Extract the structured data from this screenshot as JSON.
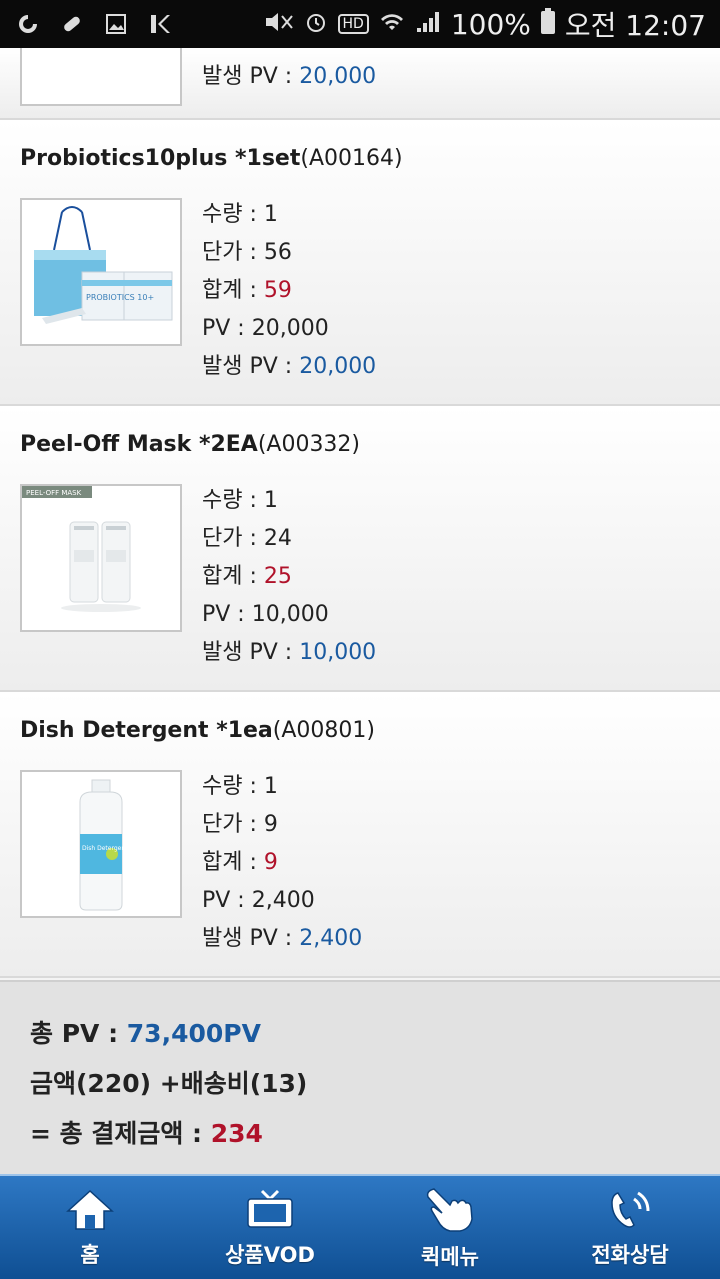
{
  "statusbar": {
    "left_icons": [
      "sync-icon",
      "pill-icon",
      "image-icon",
      "k-icon"
    ],
    "right_icons": [
      "mute-icon",
      "alarm-icon",
      "hd-icon",
      "wifi-icon",
      "signal-icon"
    ],
    "battery_text": "100%",
    "time": "오전 12:07",
    "hd_text": "HD"
  },
  "items": [
    {
      "issued_pv_label": "발생 PV : ",
      "issued_pv_value": "20,000"
    },
    {
      "name": "Probiotics10plus *1set",
      "code": "(A00164)",
      "qty_label": "수량 : ",
      "qty": "1",
      "price_label": "단가 : ",
      "price": "56",
      "total_label": "합계 : ",
      "total": "59",
      "pv_label": "PV : ",
      "pv": "20,000",
      "issued_pv_label": "발생 PV : ",
      "issued_pv_value": "20,000",
      "thumb_text": "PROBIOTICS 10+"
    },
    {
      "name": "Peel-Off Mask *2EA",
      "code": "(A00332)",
      "qty_label": "수량 : ",
      "qty": "1",
      "price_label": "단가 : ",
      "price": "24",
      "total_label": "합계 : ",
      "total": "25",
      "pv_label": "PV : ",
      "pv": "10,000",
      "issued_pv_label": "발생 PV : ",
      "issued_pv_value": "10,000",
      "thumb_text": "PEEL-OFF MASK"
    },
    {
      "name": "Dish Detergent *1ea",
      "code": "(A00801)",
      "qty_label": "수량 : ",
      "qty": "1",
      "price_label": "단가 : ",
      "price": "9",
      "total_label": "합계 : ",
      "total": "9",
      "pv_label": "PV : ",
      "pv": "2,400",
      "issued_pv_label": "발생 PV : ",
      "issued_pv_value": "2,400",
      "thumb_text": "Dish Detergent"
    }
  ],
  "summary": {
    "total_pv_label": "총 PV : ",
    "total_pv_value": "73,400PV",
    "amount_text": "금액(220) +배송비(13)",
    "pay_label": "= 총 결제금액 : ",
    "pay_value": "234"
  },
  "bottomnav": [
    {
      "label": "홈",
      "icon": "home-icon"
    },
    {
      "label": "상품VOD",
      "icon": "tv-icon"
    },
    {
      "label": "퀵메뉴",
      "icon": "hand-pointer-icon"
    },
    {
      "label": "전화상담",
      "icon": "phone-icon"
    }
  ],
  "colors": {
    "accent_blue": "#1a5aa0",
    "accent_red": "#b0122a",
    "nav_bg": "#1d64ae"
  }
}
